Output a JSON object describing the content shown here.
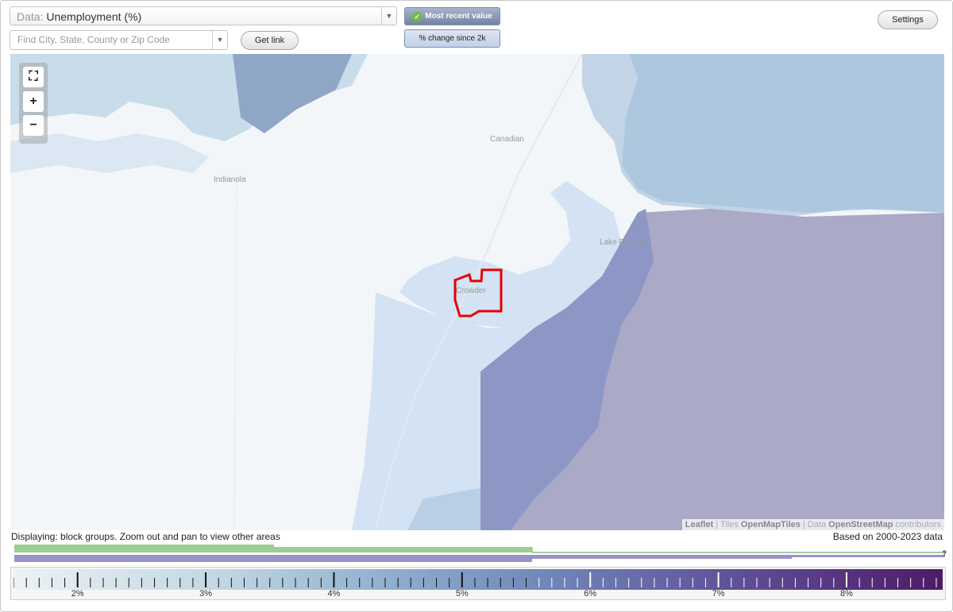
{
  "data_select": {
    "prefix": "Data:",
    "value": "Unemployment (%)"
  },
  "toggles": {
    "recent": "Most recent value",
    "change": "% change since 2k"
  },
  "search": {
    "placeholder": "Find City, State, County or Zip Code"
  },
  "buttons": {
    "get_link": "Get link",
    "settings": "Settings"
  },
  "map": {
    "zoom": {
      "fit": "⛶",
      "in": "+",
      "out": "−"
    },
    "places": [
      "Canadian",
      "Indianola",
      "Lake Eufaula",
      "Crowder"
    ],
    "attribution": {
      "leaflet": "Leaflet",
      "sep1": " | Tiles ",
      "tiles": "OpenMapTiles",
      "sep2": " | Data ",
      "data": "OpenStreetMap",
      "contrib": " contributors"
    }
  },
  "status": {
    "displaying": "Displaying: block groups. Zoom out and pan to view other areas",
    "based_on": "Based on 2000-2023 data"
  },
  "histogram": {
    "help": "?"
  },
  "legend": {
    "labels": [
      "2%",
      "3%",
      "4%",
      "5%",
      "6%",
      "7%",
      "8%"
    ],
    "min_value": 1.5,
    "max_value": 8.75
  },
  "colors": {
    "water": "#d3e3f3",
    "selected_outline": "#e80000",
    "ramp_low": "#ecf2f5",
    "ramp_high": "#4e1a67"
  }
}
